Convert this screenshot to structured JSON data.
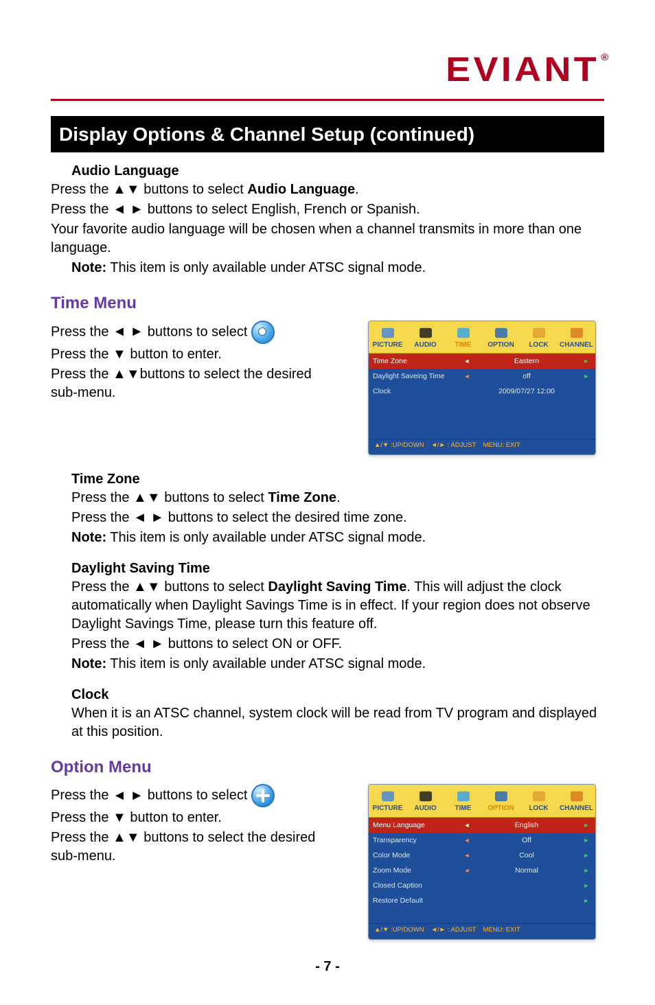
{
  "brand": {
    "name": "EVIANT",
    "registered": "®"
  },
  "title": "Display Options & Channel Setup (continued)",
  "glyph": {
    "up": "▲",
    "down": "▼",
    "left": "◄",
    "right": "►"
  },
  "audio_language": {
    "heading": "Audio Language",
    "line1_a": "Press the ",
    "line1_sym": "▲▼",
    "line1_b": " buttons to select ",
    "line1_bold": "Audio Language",
    "line1_c": ".",
    "line2_a": "Press the ",
    "line2_sym": "◄ ►",
    "line2_b": " buttons to select English, French or Spanish.",
    "line3": "Your favorite audio language will be chosen when a channel transmits in more than one language.",
    "note_label": "Note:",
    "note_text": " This item is only available under ATSC signal mode."
  },
  "time_menu": {
    "heading": "Time Menu",
    "l1_a": "Press the ",
    "l1_sym": "◄ ►",
    "l1_b": " buttons to select ",
    "l2_a": "Press the ",
    "l2_sym": "▼",
    "l2_b": " button to enter.",
    "l3_a": "Press the ",
    "l3_sym": "▲▼",
    "l3_b": "buttons to select the desired sub-menu."
  },
  "time_zone": {
    "heading": "Time Zone",
    "l1_a": "Press the ",
    "l1_sym": "▲▼",
    "l1_b": " buttons to select ",
    "l1_bold": "Time Zone",
    "l1_c": ".",
    "l2_a": "Press the ",
    "l2_sym": "◄ ►",
    "l2_b": " buttons to select the desired time zone.",
    "note_label": "Note:",
    "note_text": " This item is only available under ATSC signal mode."
  },
  "dst": {
    "heading": "Daylight Saving Time",
    "l1_a": "Press the ",
    "l1_sym": "▲▼",
    "l1_b": " buttons to select ",
    "l1_bold": "Daylight Saving Time",
    "l1_c": ". This will adjust the clock automatically when Daylight Savings Time is in effect. If your region does not observe Daylight Savings Time, please turn this feature off.",
    "l2_a": "Press the ",
    "l2_sym": "◄ ►",
    "l2_b": " buttons to select ON or OFF.",
    "note_label": "Note:",
    "note_text": " This item is only available under ATSC signal mode."
  },
  "clock": {
    "heading": "Clock",
    "body": "When it is an ATSC channel, system clock will be read from TV program and displayed at this position."
  },
  "option_menu": {
    "heading": "Option Menu",
    "l1_a": "Press the ",
    "l1_sym": "◄ ►",
    "l1_b": " buttons to select ",
    "l2_a": "Press the ",
    "l2_sym": "▼",
    "l2_b": " button to enter.",
    "l3_a": "Press the ",
    "l3_sym": "▲▼",
    "l3_b": " buttons to select the desired sub-menu."
  },
  "osd": {
    "tabs": [
      "PICTURE",
      "AUDIO",
      "TIME",
      "OPTION",
      "LOCK",
      "CHANNEL"
    ],
    "time": {
      "active_tab": "TIME",
      "rows": [
        {
          "label": "Time Zone",
          "value": "Eastern",
          "selected": true,
          "arrows": true
        },
        {
          "label": "Daylight Saveing Time",
          "value": "off",
          "selected": false,
          "arrows": true
        },
        {
          "label": "Clock",
          "value": "2009/07/27 12:00",
          "selected": false,
          "arrows": false
        }
      ]
    },
    "option": {
      "active_tab": "OPTION",
      "rows": [
        {
          "label": "Menu Language",
          "value": "English",
          "selected": true,
          "arrows": true
        },
        {
          "label": "Transparency",
          "value": "Off",
          "selected": false,
          "arrows": true
        },
        {
          "label": "Color Mode",
          "value": "Cool",
          "selected": false,
          "arrows": true
        },
        {
          "label": "Zoom Mode",
          "value": "Normal",
          "selected": false,
          "arrows": true
        },
        {
          "label": "Closed Caption",
          "value": "",
          "selected": false,
          "arrows": "right"
        },
        {
          "label": "Restore Default",
          "value": "",
          "selected": false,
          "arrows": "right"
        }
      ]
    },
    "footer": {
      "a": "▲/▼ :UP/DOWN",
      "b": "◄/► : ADJUST",
      "c": "MENU: EXIT"
    }
  },
  "page_number": "- 7 -"
}
